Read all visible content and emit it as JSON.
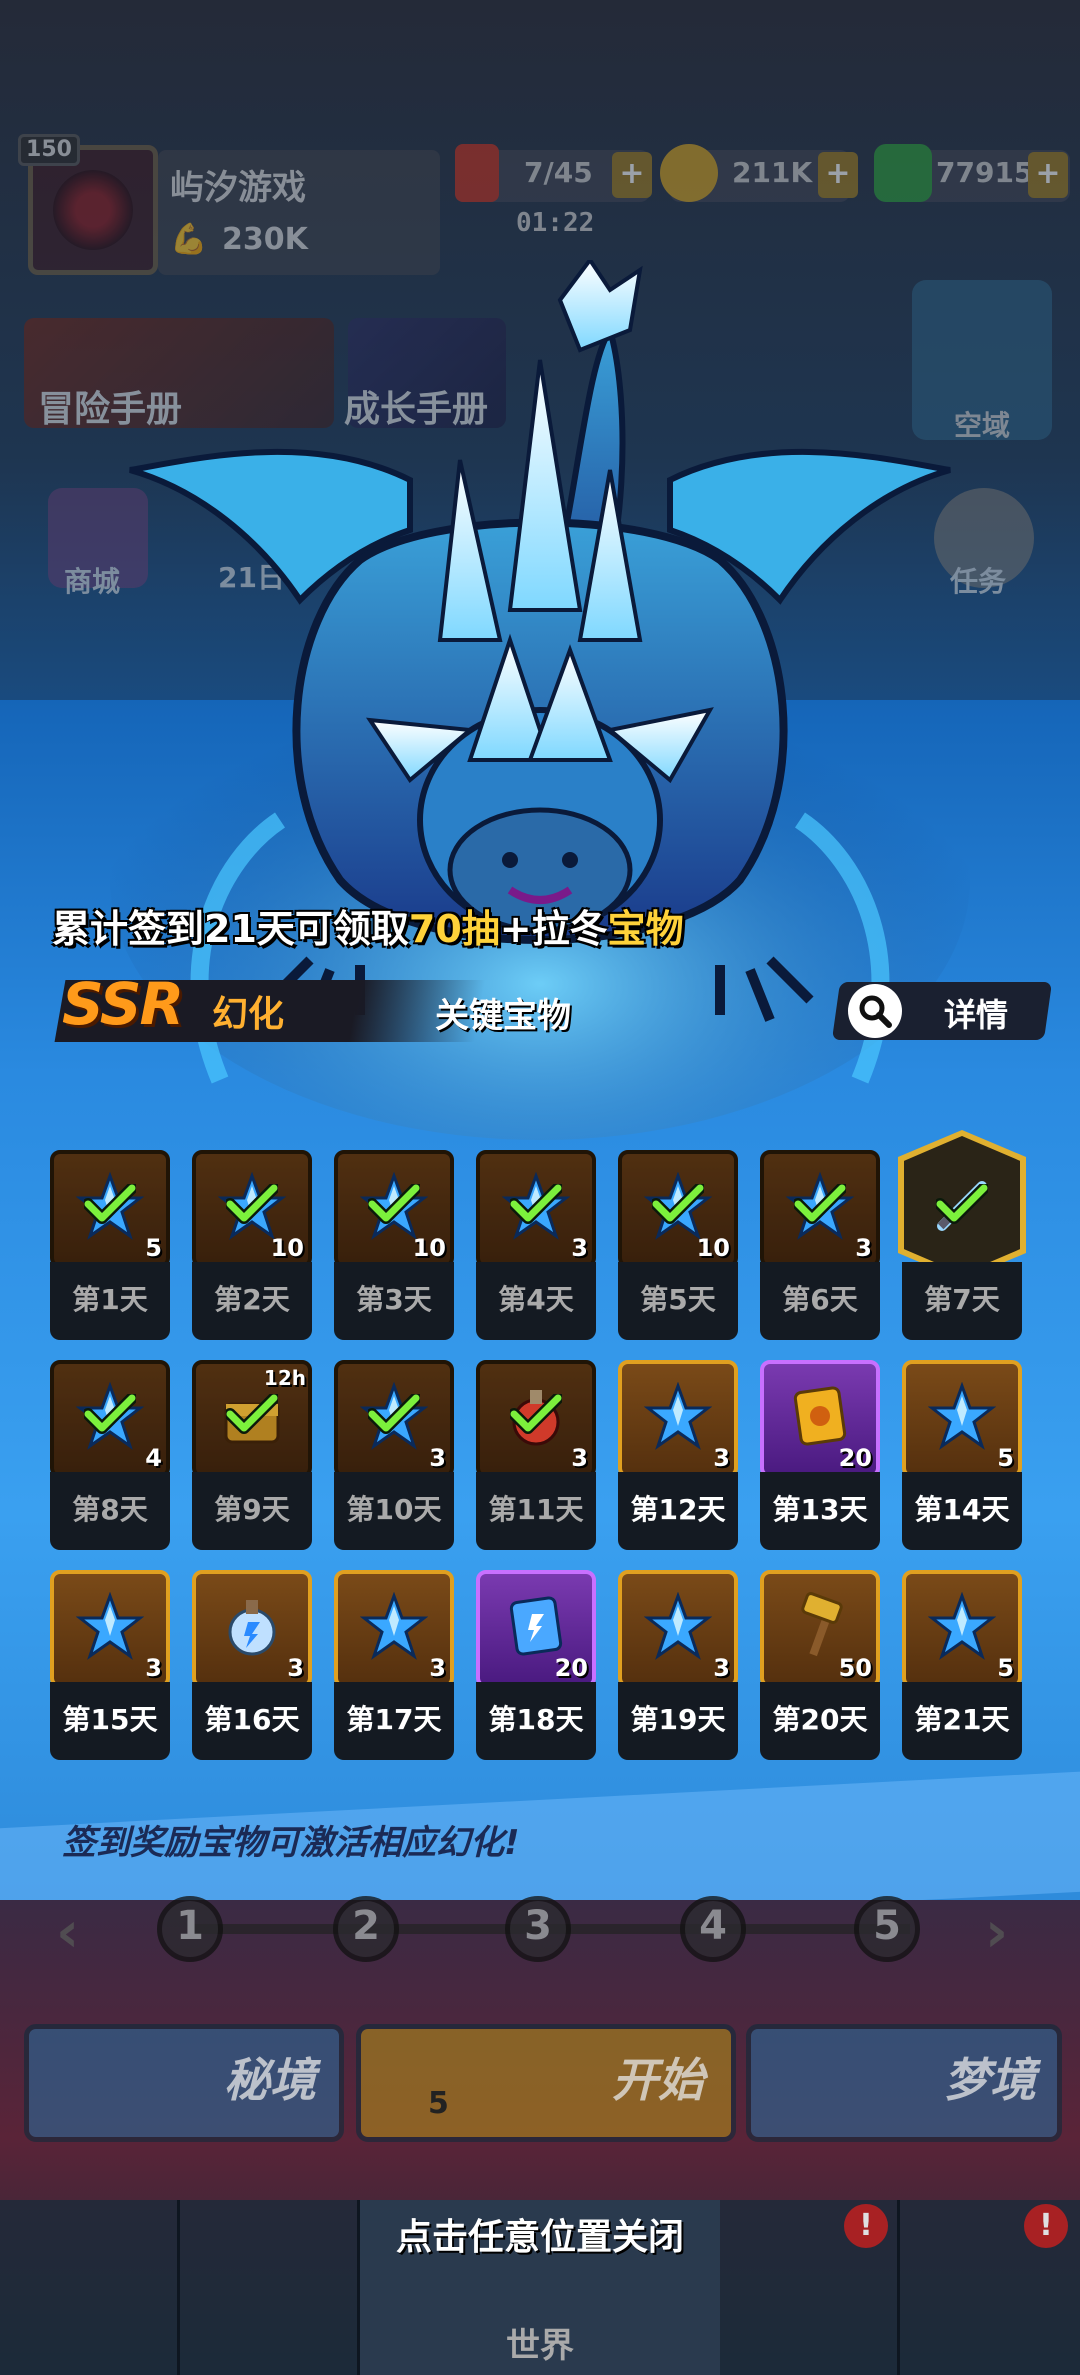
{
  "player": {
    "level": "150",
    "name": "屿汐游戏",
    "power": "230K"
  },
  "resources": {
    "energy": "7/45",
    "energy_timer": "01:22",
    "gold": "211K",
    "gems": "77915",
    "plus": "+"
  },
  "top_menu": {
    "adventure_manual": "冒险手册",
    "growth_manual": "成长手册",
    "airspace": "空域",
    "shop": "商城",
    "day21": "21日",
    "tasks": "任务"
  },
  "popup": {
    "cumulative_prefix": "累计签到21天可领取",
    "cumulative_draws": "70抽",
    "cumulative_mid": "+拉冬",
    "cumulative_treasure": "宝物",
    "rarity": "SSR",
    "skin_type": "幻化",
    "key_treasure": "关键宝物",
    "details": "详情",
    "reward_note": "签到奖励宝物可激活相应幻化!",
    "close_hint": "点击任意位置关闭"
  },
  "days": [
    {
      "label": "第1天",
      "qty": "5",
      "item": "blue-crystal",
      "claimed": true,
      "frame": "bronze"
    },
    {
      "label": "第2天",
      "qty": "10",
      "item": "blue-crystal",
      "claimed": true,
      "frame": "bronze"
    },
    {
      "label": "第3天",
      "qty": "10",
      "item": "blue-crystal",
      "claimed": true,
      "frame": "bronze"
    },
    {
      "label": "第4天",
      "qty": "3",
      "item": "blue-crystal",
      "claimed": true,
      "frame": "bronze"
    },
    {
      "label": "第5天",
      "qty": "10",
      "item": "blue-crystal",
      "claimed": true,
      "frame": "bronze"
    },
    {
      "label": "第6天",
      "qty": "3",
      "item": "blue-crystal",
      "claimed": true,
      "frame": "bronze"
    },
    {
      "label": "第7天",
      "qty": "",
      "item": "ice-sword",
      "claimed": true,
      "frame": "hex"
    },
    {
      "label": "第8天",
      "qty": "4",
      "item": "blue-crystal",
      "claimed": true,
      "frame": "bronze"
    },
    {
      "label": "第9天",
      "qty": "",
      "item": "chest-12h",
      "claimed": true,
      "frame": "bronze",
      "tag": "12h"
    },
    {
      "label": "第10天",
      "qty": "3",
      "item": "blue-crystal",
      "claimed": true,
      "frame": "bronze"
    },
    {
      "label": "第11天",
      "qty": "3",
      "item": "red-potion",
      "claimed": true,
      "frame": "bronze"
    },
    {
      "label": "第12天",
      "qty": "3",
      "item": "blue-crystal",
      "claimed": false,
      "frame": "gold"
    },
    {
      "label": "第13天",
      "qty": "20",
      "item": "gold-ticket",
      "claimed": false,
      "frame": "purple"
    },
    {
      "label": "第14天",
      "qty": "5",
      "item": "blue-crystal",
      "claimed": false,
      "frame": "gold"
    },
    {
      "label": "第15天",
      "qty": "3",
      "item": "blue-crystal",
      "claimed": false,
      "frame": "gold"
    },
    {
      "label": "第16天",
      "qty": "3",
      "item": "blue-potion",
      "claimed": false,
      "frame": "gold"
    },
    {
      "label": "第17天",
      "qty": "3",
      "item": "blue-crystal",
      "claimed": false,
      "frame": "gold"
    },
    {
      "label": "第18天",
      "qty": "20",
      "item": "blue-ticket",
      "claimed": false,
      "frame": "purple"
    },
    {
      "label": "第19天",
      "qty": "3",
      "item": "blue-crystal",
      "claimed": false,
      "frame": "gold"
    },
    {
      "label": "第20天",
      "qty": "50",
      "item": "gold-hammer",
      "claimed": false,
      "frame": "gold"
    },
    {
      "label": "第21天",
      "qty": "5",
      "item": "blue-crystal",
      "claimed": false,
      "frame": "gold"
    }
  ],
  "pager": {
    "pages": [
      "1",
      "2",
      "3",
      "4",
      "5"
    ],
    "prev": "‹",
    "next": "›"
  },
  "modes": {
    "secret_realm": "秘境",
    "start": "开始",
    "start_cost": "5",
    "dream_realm": "梦境"
  },
  "nav": {
    "world": "世界",
    "alert": "!"
  },
  "colors": {
    "ssr_orange": "#ff9a1a",
    "highlight_yellow": "#ffd23a",
    "check_green": "#7cf03c",
    "crystal_blue": "#3aa8ff"
  }
}
